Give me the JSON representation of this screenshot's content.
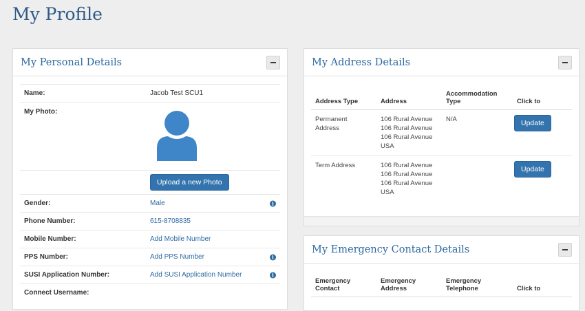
{
  "page": {
    "title": "My Profile"
  },
  "personal": {
    "title": "My Personal Details",
    "name_label": "Name:",
    "name_value": "Jacob Test SCU1",
    "photo_label": "My Photo:",
    "upload_label": "Upload a new Photo",
    "gender_label": "Gender:",
    "gender_value": "Male",
    "phone_label": "Phone Number:",
    "phone_value": "615-8708835",
    "mobile_label": "Mobile Number:",
    "mobile_value": "Add Mobile Number",
    "pps_label": "PPS Number:",
    "pps_value": "Add PPS Number",
    "susi_label": "SUSI Application Number:",
    "susi_value": "Add SUSI Application Number",
    "connect_label": "Connect Username:",
    "info_glyph": "i"
  },
  "address": {
    "title": "My Address Details",
    "headers": {
      "type": "Address Type",
      "address": "Address",
      "accommodation": "Accommodation Type",
      "click": "Click to"
    },
    "rows": [
      {
        "type": "Permanent Address",
        "lines": [
          "106 Rural Avenue",
          "106 Rural Avenue",
          "106 Rural Avenue",
          "USA"
        ],
        "accommodation": "N/A",
        "button": "Update"
      },
      {
        "type": "Term Address",
        "lines": [
          "106 Rural Avenue",
          "106 Rural Avenue",
          "106 Rural Avenue",
          "USA"
        ],
        "accommodation": "",
        "button": "Update"
      }
    ]
  },
  "emergency": {
    "title": "My Emergency Contact Details",
    "headers": {
      "contact": "Emergency Contact",
      "address": "Emergency Address",
      "telephone": "Emergency Telephone",
      "click": "Click to"
    }
  }
}
